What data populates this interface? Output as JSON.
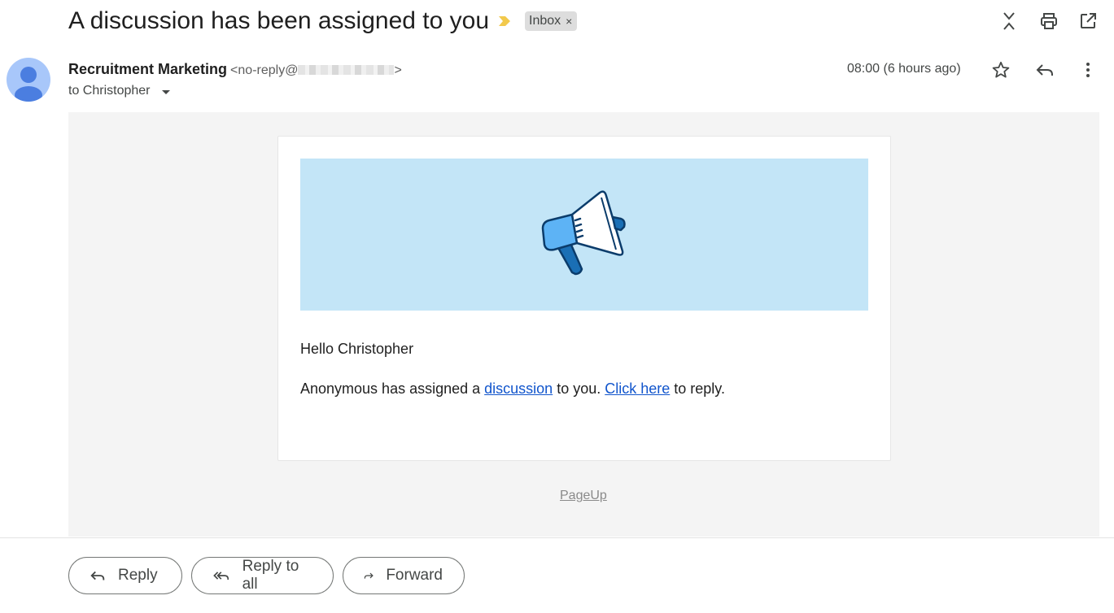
{
  "email": {
    "subject": "A discussion has been assigned to you",
    "label_chip": "Inbox",
    "label_chip_close": "×",
    "sender_name": "Recruitment Marketing",
    "sender_email_prefix": "<no-reply@",
    "sender_email_suffix": ">",
    "recipient": "to Christopher",
    "timestamp": "08:00 (6 hours ago)"
  },
  "body": {
    "greeting": "Hello Christopher",
    "message_part1": "Anonymous has assigned a ",
    "link_discussion": "discussion",
    "message_part2": " to you. ",
    "link_click_here": "Click here",
    "message_part3": " to reply.",
    "footer_link": "PageUp"
  },
  "actions": {
    "reply": "Reply",
    "reply_all": "Reply to all",
    "forward": "Forward"
  },
  "icons": {
    "label_marker": "importance-marker-icon",
    "collapse": "collapse-all-icon",
    "print": "print-icon",
    "new_window": "open-in-new-window-icon",
    "star": "star-icon",
    "reply": "reply-icon",
    "more": "more-vert-icon",
    "banner": "megaphone-icon"
  },
  "colors": {
    "banner_bg": "#c3e5f7",
    "link": "#1155cc",
    "importance_marker": "#f2c94c",
    "avatar_bg": "#a8c7fa",
    "avatar_fg": "#4b7ee0"
  }
}
